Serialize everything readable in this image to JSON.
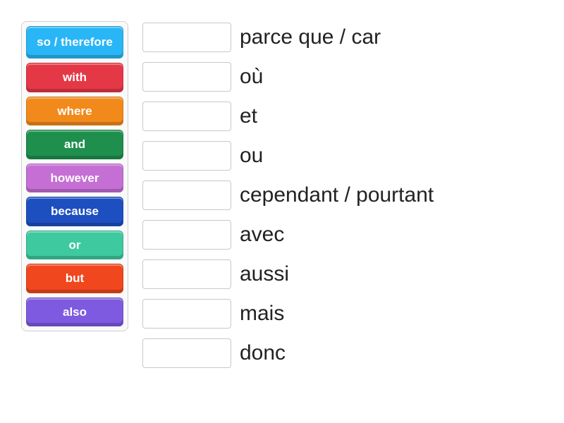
{
  "sourceTiles": [
    {
      "id": "tile-so-therefore",
      "label": "so / therefore",
      "color": "#29b6f6",
      "tall": true
    },
    {
      "id": "tile-with",
      "label": "with",
      "color": "#e53846",
      "tall": false
    },
    {
      "id": "tile-where",
      "label": "where",
      "color": "#f28a1b",
      "tall": false
    },
    {
      "id": "tile-and",
      "label": "and",
      "color": "#1f8f4d",
      "tall": false
    },
    {
      "id": "tile-however",
      "label": "however",
      "color": "#c56fd5",
      "tall": false
    },
    {
      "id": "tile-because",
      "label": "because",
      "color": "#1e4fc1",
      "tall": false
    },
    {
      "id": "tile-or",
      "label": "or",
      "color": "#3ec99e",
      "tall": false
    },
    {
      "id": "tile-but",
      "label": "but",
      "color": "#f1471e",
      "tall": false
    },
    {
      "id": "tile-also",
      "label": "also",
      "color": "#7d5ae0",
      "tall": false
    }
  ],
  "targets": [
    {
      "id": "target-parce-que",
      "label": "parce que / car"
    },
    {
      "id": "target-ou-grave",
      "label": "où"
    },
    {
      "id": "target-et",
      "label": "et"
    },
    {
      "id": "target-ou",
      "label": "ou"
    },
    {
      "id": "target-cependant",
      "label": "cependant / pourtant"
    },
    {
      "id": "target-avec",
      "label": "avec"
    },
    {
      "id": "target-aussi",
      "label": "aussi"
    },
    {
      "id": "target-mais",
      "label": "mais"
    },
    {
      "id": "target-donc",
      "label": "donc"
    }
  ]
}
